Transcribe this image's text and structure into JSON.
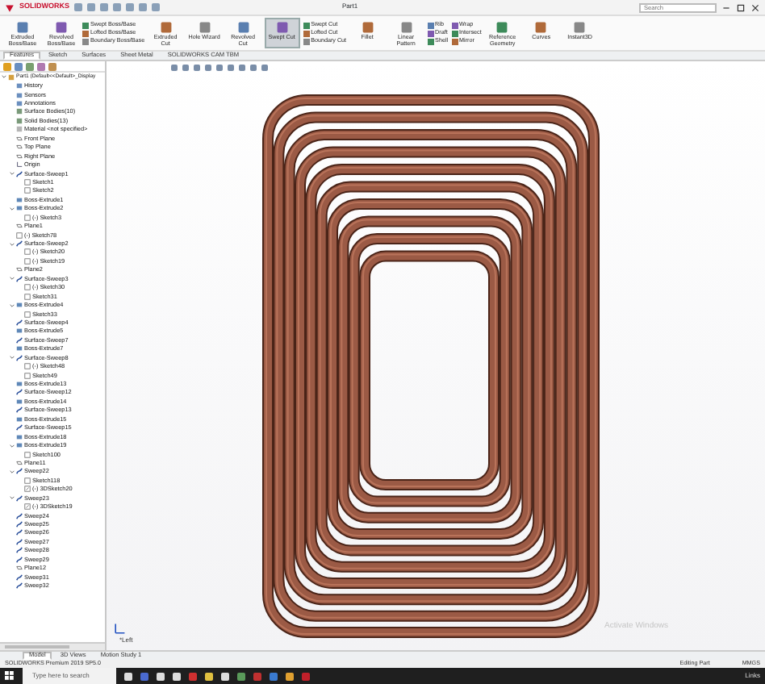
{
  "window": {
    "app": "SOLIDWORKS",
    "title": "Part1"
  },
  "search": {
    "placeholder": "Search"
  },
  "ribbon": [
    {
      "kind": "large",
      "label": "Extruded Boss/Base",
      "selected": false
    },
    {
      "kind": "large",
      "label": "Revolved Boss/Base",
      "selected": false
    },
    {
      "kind": "stack",
      "items": [
        "Swept Boss/Base",
        "Lofted Boss/Base",
        "Boundary Boss/Base"
      ]
    },
    {
      "kind": "large",
      "label": "Extruded Cut",
      "selected": false
    },
    {
      "kind": "large",
      "label": "Hole Wizard",
      "selected": false
    },
    {
      "kind": "large",
      "label": "Revolved Cut",
      "selected": false
    },
    {
      "kind": "large",
      "label": "Swept Cut",
      "selected": true
    },
    {
      "kind": "stack",
      "items": [
        "Swept Cut",
        "Lofted Cut",
        "Boundary Cut"
      ]
    },
    {
      "kind": "large",
      "label": "Fillet",
      "selected": false
    },
    {
      "kind": "large",
      "label": "Linear Pattern",
      "selected": false
    },
    {
      "kind": "stack",
      "items": [
        "Rib",
        "Draft",
        "Shell"
      ]
    },
    {
      "kind": "stack",
      "items": [
        "Wrap",
        "Intersect",
        "Mirror"
      ]
    },
    {
      "kind": "large",
      "label": "Reference Geometry",
      "selected": false
    },
    {
      "kind": "large",
      "label": "Curves",
      "selected": false
    },
    {
      "kind": "large",
      "label": "Instant3D",
      "selected": false
    }
  ],
  "command_tabs": [
    {
      "label": "Features",
      "selected": true
    },
    {
      "label": "Sketch",
      "selected": false
    },
    {
      "label": "Surfaces",
      "selected": false
    },
    {
      "label": "Sheet Metal",
      "selected": false
    },
    {
      "label": "SOLIDWORKS CAM TBM",
      "selected": false
    }
  ],
  "tree": [
    {
      "kind": "part",
      "label": "Part1 (Default<<Default>_Display",
      "children": [
        {
          "kind": "folder",
          "label": "History"
        },
        {
          "kind": "folder",
          "label": "Sensors"
        },
        {
          "kind": "folder",
          "label": "Annotations"
        },
        {
          "kind": "bodies",
          "label": "Surface Bodies(10)"
        },
        {
          "kind": "bodies",
          "label": "Solid Bodies(13)"
        },
        {
          "kind": "material",
          "label": "Material <not specified>"
        },
        {
          "kind": "plane",
          "label": "Front Plane"
        },
        {
          "kind": "plane",
          "label": "Top Plane"
        },
        {
          "kind": "plane",
          "label": "Right Plane"
        },
        {
          "kind": "origin",
          "label": "Origin"
        },
        {
          "kind": "sweep",
          "label": "Surface-Sweep1",
          "children": [
            {
              "kind": "sketch",
              "label": "Sketch1"
            },
            {
              "kind": "sketch",
              "label": "Sketch2"
            }
          ]
        },
        {
          "kind": "extrude",
          "label": "Boss-Extrude1"
        },
        {
          "kind": "extrude",
          "label": "Boss-Extrude2",
          "children": [
            {
              "kind": "sketch",
              "label": "(-) Sketch3"
            }
          ]
        },
        {
          "kind": "plane",
          "label": "Plane1"
        },
        {
          "kind": "sketch",
          "label": "(-) Sketch78"
        },
        {
          "kind": "sweep",
          "label": "Surface-Sweep2",
          "children": [
            {
              "kind": "sketch",
              "label": "(-) Sketch20"
            },
            {
              "kind": "sketch",
              "label": "(-) Sketch19"
            }
          ]
        },
        {
          "kind": "plane",
          "label": "Plane2"
        },
        {
          "kind": "sweep",
          "label": "Surface-Sweep3",
          "children": [
            {
              "kind": "sketch",
              "label": "(-) Sketch30"
            },
            {
              "kind": "sketch",
              "label": "Sketch31"
            }
          ]
        },
        {
          "kind": "extrude",
          "label": "Boss-Extrude4",
          "children": [
            {
              "kind": "sketch",
              "label": "Sketch33"
            }
          ]
        },
        {
          "kind": "sweep",
          "label": "Surface-Sweep4"
        },
        {
          "kind": "extrude",
          "label": "Boss-Extrude5"
        },
        {
          "kind": "sweep",
          "label": "Surface-Sweep7"
        },
        {
          "kind": "extrude",
          "label": "Boss-Extrude7"
        },
        {
          "kind": "sweep",
          "label": "Surface-Sweep8",
          "children": [
            {
              "kind": "sketch",
              "label": "(-) Sketch48"
            },
            {
              "kind": "sketch",
              "label": "Sketch49"
            }
          ]
        },
        {
          "kind": "extrude",
          "label": "Boss-Extrude13"
        },
        {
          "kind": "sweep",
          "label": "Surface-Sweep12"
        },
        {
          "kind": "extrude",
          "label": "Boss-Extrude14"
        },
        {
          "kind": "sweep",
          "label": "Surface-Sweep13"
        },
        {
          "kind": "extrude",
          "label": "Boss-Extrude15"
        },
        {
          "kind": "sweep",
          "label": "Surface-Sweep15"
        },
        {
          "kind": "extrude",
          "label": "Boss-Extrude18"
        },
        {
          "kind": "extrude",
          "label": "Boss-Extrude19",
          "children": [
            {
              "kind": "sketch",
              "label": "Sketch100"
            }
          ]
        },
        {
          "kind": "plane",
          "label": "Plane11"
        },
        {
          "kind": "sweep",
          "label": "Sweep22",
          "children": [
            {
              "kind": "sketch",
              "label": "Sketch118"
            },
            {
              "kind": "sketch3d",
              "label": "(-) 3DSketch20"
            }
          ]
        },
        {
          "kind": "sweep",
          "label": "Sweep23",
          "children": [
            {
              "kind": "sketch3d",
              "label": "(-) 3DSketch19"
            }
          ]
        },
        {
          "kind": "sweep",
          "label": "Sweep24"
        },
        {
          "kind": "sweep",
          "label": "Sweep25"
        },
        {
          "kind": "sweep",
          "label": "Sweep26"
        },
        {
          "kind": "sweep",
          "label": "Sweep27"
        },
        {
          "kind": "sweep",
          "label": "Sweep28"
        },
        {
          "kind": "sweep",
          "label": "Sweep29"
        },
        {
          "kind": "plane",
          "label": "Plane12"
        },
        {
          "kind": "sweep",
          "label": "Sweep31"
        },
        {
          "kind": "sweep",
          "label": "Sweep32"
        }
      ]
    }
  ],
  "view": {
    "orientation": "*Left",
    "notice": "Activate Windows"
  },
  "bottom_tabs": [
    {
      "label": "Model",
      "selected": true
    },
    {
      "label": "3D Views",
      "selected": false
    },
    {
      "label": "Motion Study 1",
      "selected": false
    }
  ],
  "status_bar": {
    "product": "SOLIDWORKS Premium 2019 SP5.0",
    "mode": "Editing Part",
    "units": "MMGS"
  },
  "taskbar": {
    "search_placeholder": "Type here to search",
    "links": "Links"
  }
}
